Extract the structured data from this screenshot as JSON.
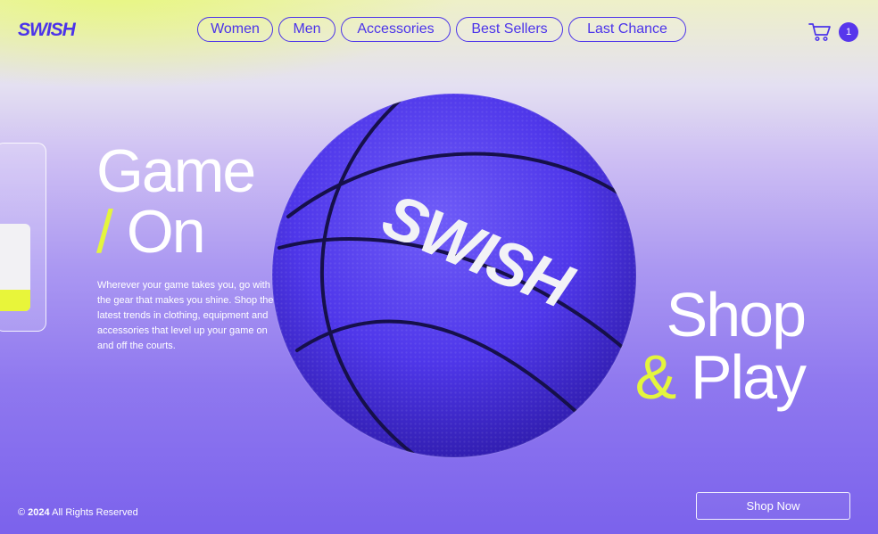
{
  "brand": {
    "logo": "SWISH",
    "color": "#4b33ea",
    "accent": "#e4f53d"
  },
  "nav": {
    "items": [
      {
        "label": "Women"
      },
      {
        "label": "Men"
      },
      {
        "label": "Accessories"
      },
      {
        "label": "Best Sellers"
      },
      {
        "label": "Last Chance"
      }
    ]
  },
  "cart": {
    "icon": "cart-icon",
    "count": "1"
  },
  "hero": {
    "line1": "Game",
    "slash": "/",
    "line2": "On",
    "intro": "Wherever your game takes you, go with the gear that makes you shine. Shop the latest trends in clothing, equipment and accessories that  level up your game on and off the courts.",
    "ball_text": "SWISH",
    "tag_line1": "Shop",
    "tag_amp": "&",
    "tag_line2": "Play"
  },
  "footer": {
    "copyright_symbol": "©",
    "year": "2024",
    "rights": "All Rights Reserved",
    "cta": "Shop Now"
  }
}
